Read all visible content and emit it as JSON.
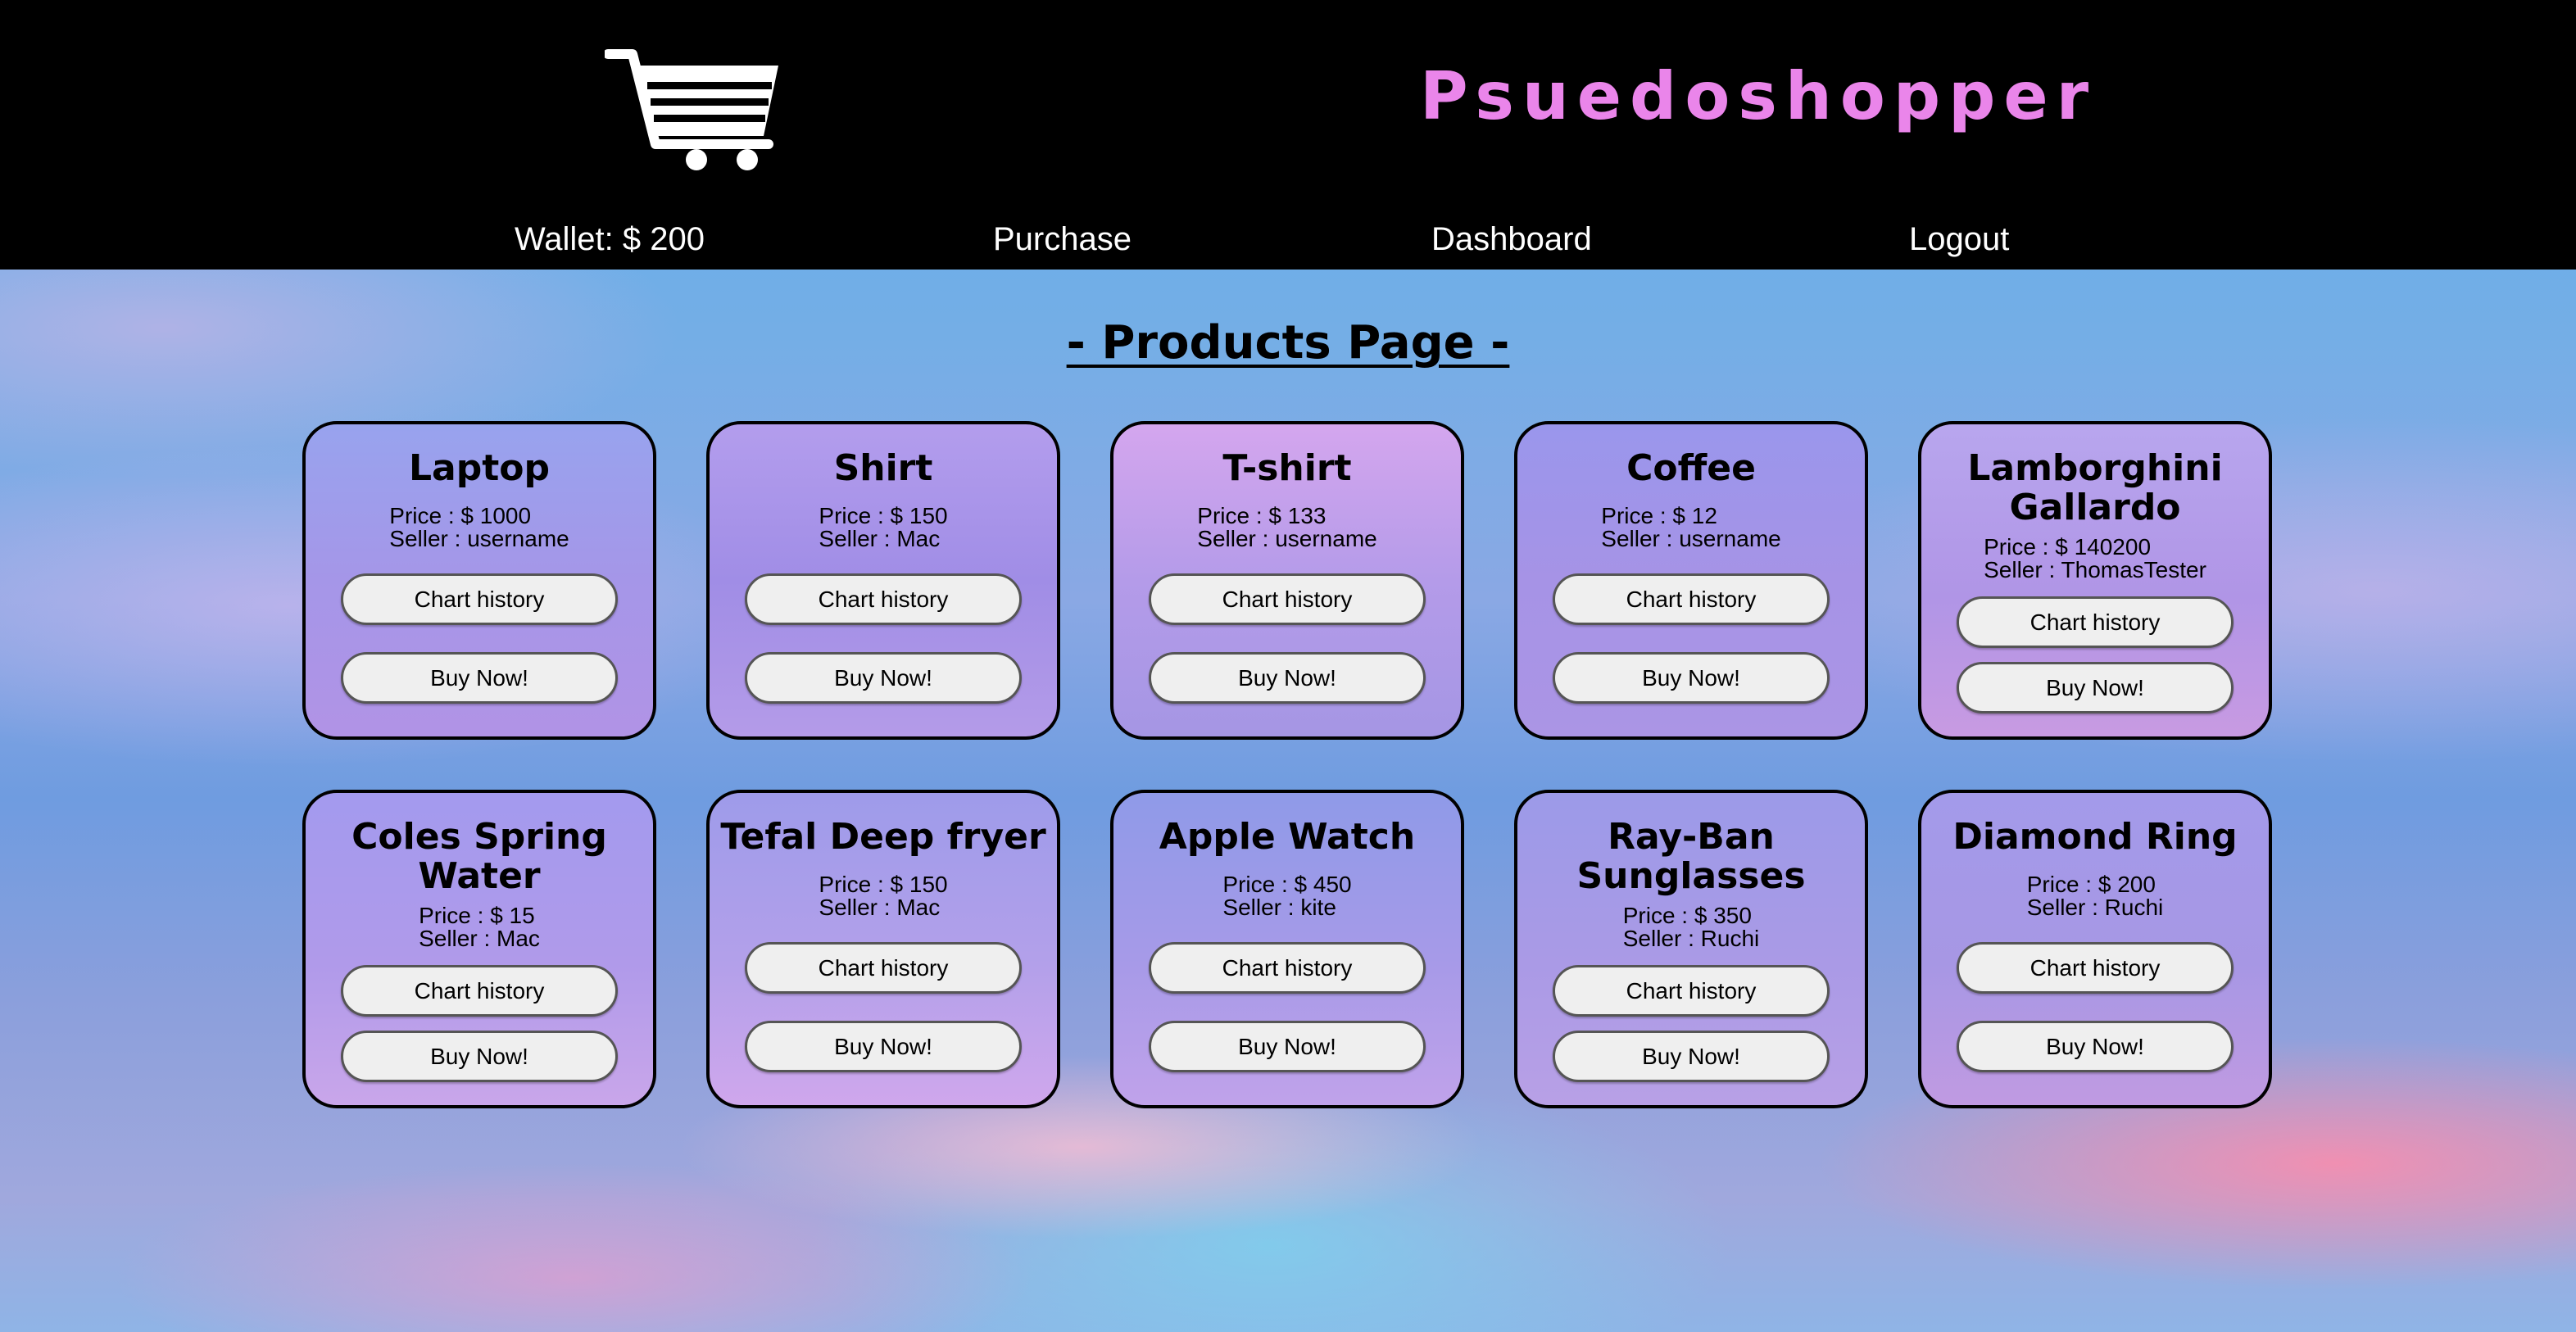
{
  "header": {
    "brand": "Psuedoshopper",
    "logo_icon": "shopping-cart-icon",
    "nav": {
      "wallet": "Wallet: $ 200",
      "purchase": "Purchase",
      "dashboard": "Dashboard",
      "logout": "Logout"
    }
  },
  "main": {
    "title": "- Products Page -"
  },
  "products": [
    {
      "name": "Laptop",
      "price": "Price : $ 1000",
      "seller": "Seller : username",
      "chart_label": "Chart history",
      "buy_label": "Buy Now!"
    },
    {
      "name": "Shirt",
      "price": "Price : $ 150",
      "seller": "Seller : Mac",
      "chart_label": "Chart history",
      "buy_label": "Buy Now!"
    },
    {
      "name": "T-shirt",
      "price": "Price : $ 133",
      "seller": "Seller : username",
      "chart_label": "Chart history",
      "buy_label": "Buy Now!"
    },
    {
      "name": "Coffee",
      "price": "Price : $ 12",
      "seller": "Seller : username",
      "chart_label": "Chart history",
      "buy_label": "Buy Now!"
    },
    {
      "name": "Lamborghini Gallardo",
      "price": "Price : $ 140200",
      "seller": "Seller : ThomasTester",
      "chart_label": "Chart history",
      "buy_label": "Buy Now!"
    },
    {
      "name": "Coles Spring Water",
      "price": "Price : $ 15",
      "seller": "Seller : Mac",
      "chart_label": "Chart history",
      "buy_label": "Buy Now!"
    },
    {
      "name": "Tefal Deep fryer",
      "price": "Price : $ 150",
      "seller": "Seller : Mac",
      "chart_label": "Chart history",
      "buy_label": "Buy Now!"
    },
    {
      "name": "Apple Watch",
      "price": "Price : $ 450",
      "seller": "Seller : kite",
      "chart_label": "Chart history",
      "buy_label": "Buy Now!"
    },
    {
      "name": "Ray-Ban Sunglasses",
      "price": "Price : $ 350",
      "seller": "Seller : Ruchi",
      "chart_label": "Chart history",
      "buy_label": "Buy Now!"
    },
    {
      "name": "Diamond Ring",
      "price": "Price : $ 200",
      "seller": "Seller : Ruchi",
      "chart_label": "Chart history",
      "buy_label": "Buy Now!"
    }
  ]
}
